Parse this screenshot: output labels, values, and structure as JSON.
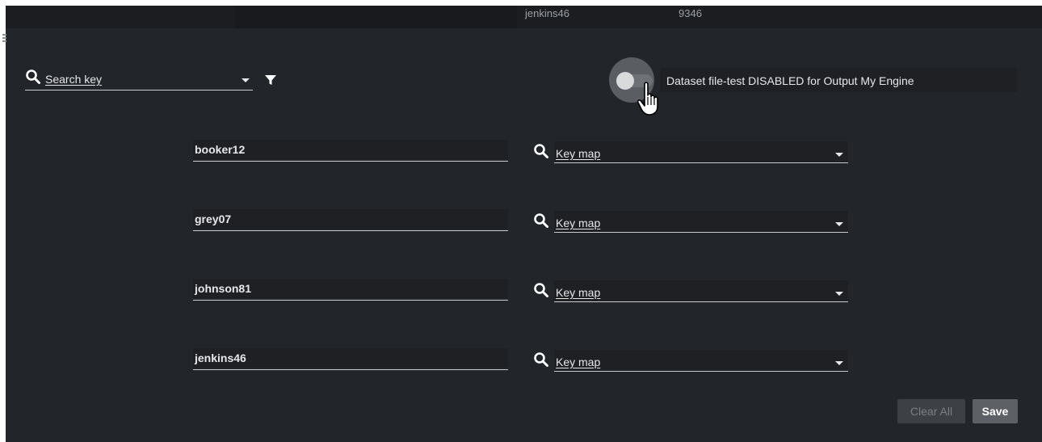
{
  "topbar": {
    "user": "jenkins46",
    "id": "9346"
  },
  "search": {
    "placeholder": "Search key"
  },
  "toggle": {
    "label": "Dataset file-test DISABLED for Output My Engine",
    "enabled": false
  },
  "rows": [
    {
      "user": "booker12",
      "keymap_placeholder": "Key map"
    },
    {
      "user": "grey07",
      "keymap_placeholder": "Key map"
    },
    {
      "user": "johnson81",
      "keymap_placeholder": "Key map"
    },
    {
      "user": "jenkins46",
      "keymap_placeholder": "Key map"
    }
  ],
  "actions": {
    "clear_label": "Clear All",
    "save_label": "Save"
  },
  "icons": {
    "search": "search-icon",
    "filter": "filter-icon",
    "dropdown": "chevron-down-icon",
    "cursor": "hand-pointer-icon"
  },
  "colors": {
    "background": "#22252a",
    "text": "#e6e7e9",
    "underline": "#c9ccd0"
  }
}
